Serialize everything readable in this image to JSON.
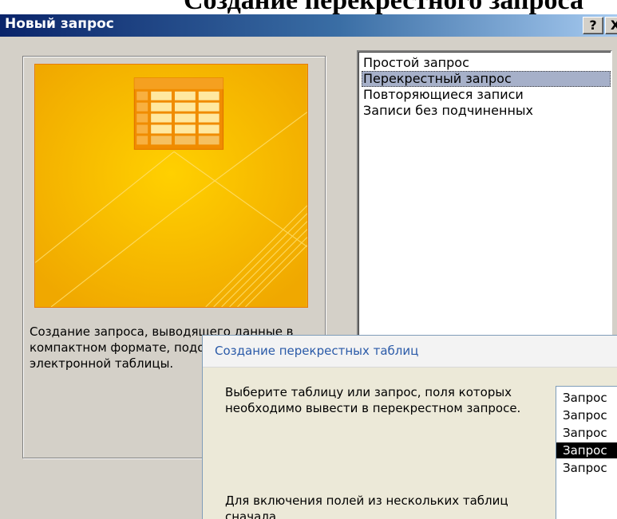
{
  "top_caption": "Создание перекрестного запроса",
  "dialog": {
    "title": "Новый запрос",
    "help_label": "?",
    "close_label": "X",
    "preview_description": "Создание запроса, выводящего данные в компактном формате, подобном формату электронной таблицы."
  },
  "query_types": {
    "items": [
      {
        "label": "Простой запрос",
        "selected": false
      },
      {
        "label": "Перекрестный запрос",
        "selected": true
      },
      {
        "label": "Повторяющиеся записи",
        "selected": false
      },
      {
        "label": "Записи без подчиненных",
        "selected": false
      }
    ]
  },
  "wizard": {
    "title": "Создание перекрестных таблиц",
    "instructions": "Выберите таблицу или запрос, поля которых необходимо вывести в перекрестном запросе.",
    "note": "Для включения полей из нескольких таблиц сначала",
    "sources": {
      "items": [
        {
          "label": "Запрос",
          "selected": false
        },
        {
          "label": "Запрос",
          "selected": false
        },
        {
          "label": "Запрос",
          "selected": false
        },
        {
          "label": "Запрос",
          "selected": true
        },
        {
          "label": "Запрос",
          "selected": false
        }
      ]
    }
  },
  "colors": {
    "title_bar_start": "#0a246a",
    "title_bar_end": "#a6caf0",
    "dialog_face": "#d4d0c8",
    "preview_orange": "#f6b400",
    "preview_border": "#e87a00",
    "list_selection": "#a6b0c9",
    "wizard_title": "#2a5aa8"
  }
}
